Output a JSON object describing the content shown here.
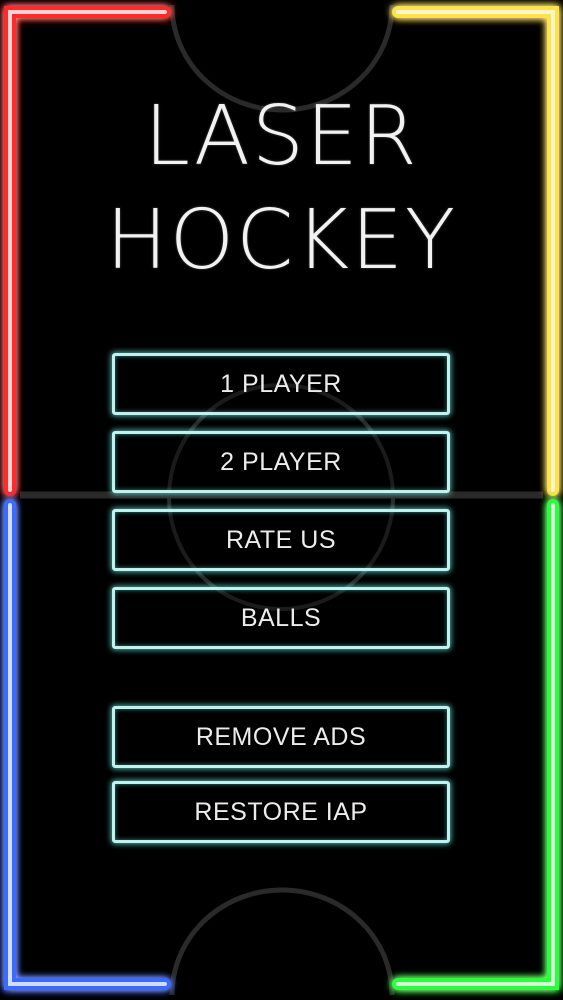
{
  "title": {
    "line1": "LASER",
    "line2": "HOCKEY"
  },
  "menu": {
    "one_player": "1 PLAYER",
    "two_player": "2 PLAYER",
    "rate_us": "RATE US",
    "balls": "BALLS",
    "remove_ads": "REMOVE ADS",
    "restore_iap": "RESTORE IAP"
  },
  "colors": {
    "background": "#000000",
    "wall_top_left": "#ff2a2a",
    "wall_top_right": "#ffe14a",
    "wall_bottom_left": "#3a6bff",
    "wall_bottom_right": "#2bff3a",
    "button_border": "#bff1ee",
    "rink_markings": "#2a2a2a"
  }
}
